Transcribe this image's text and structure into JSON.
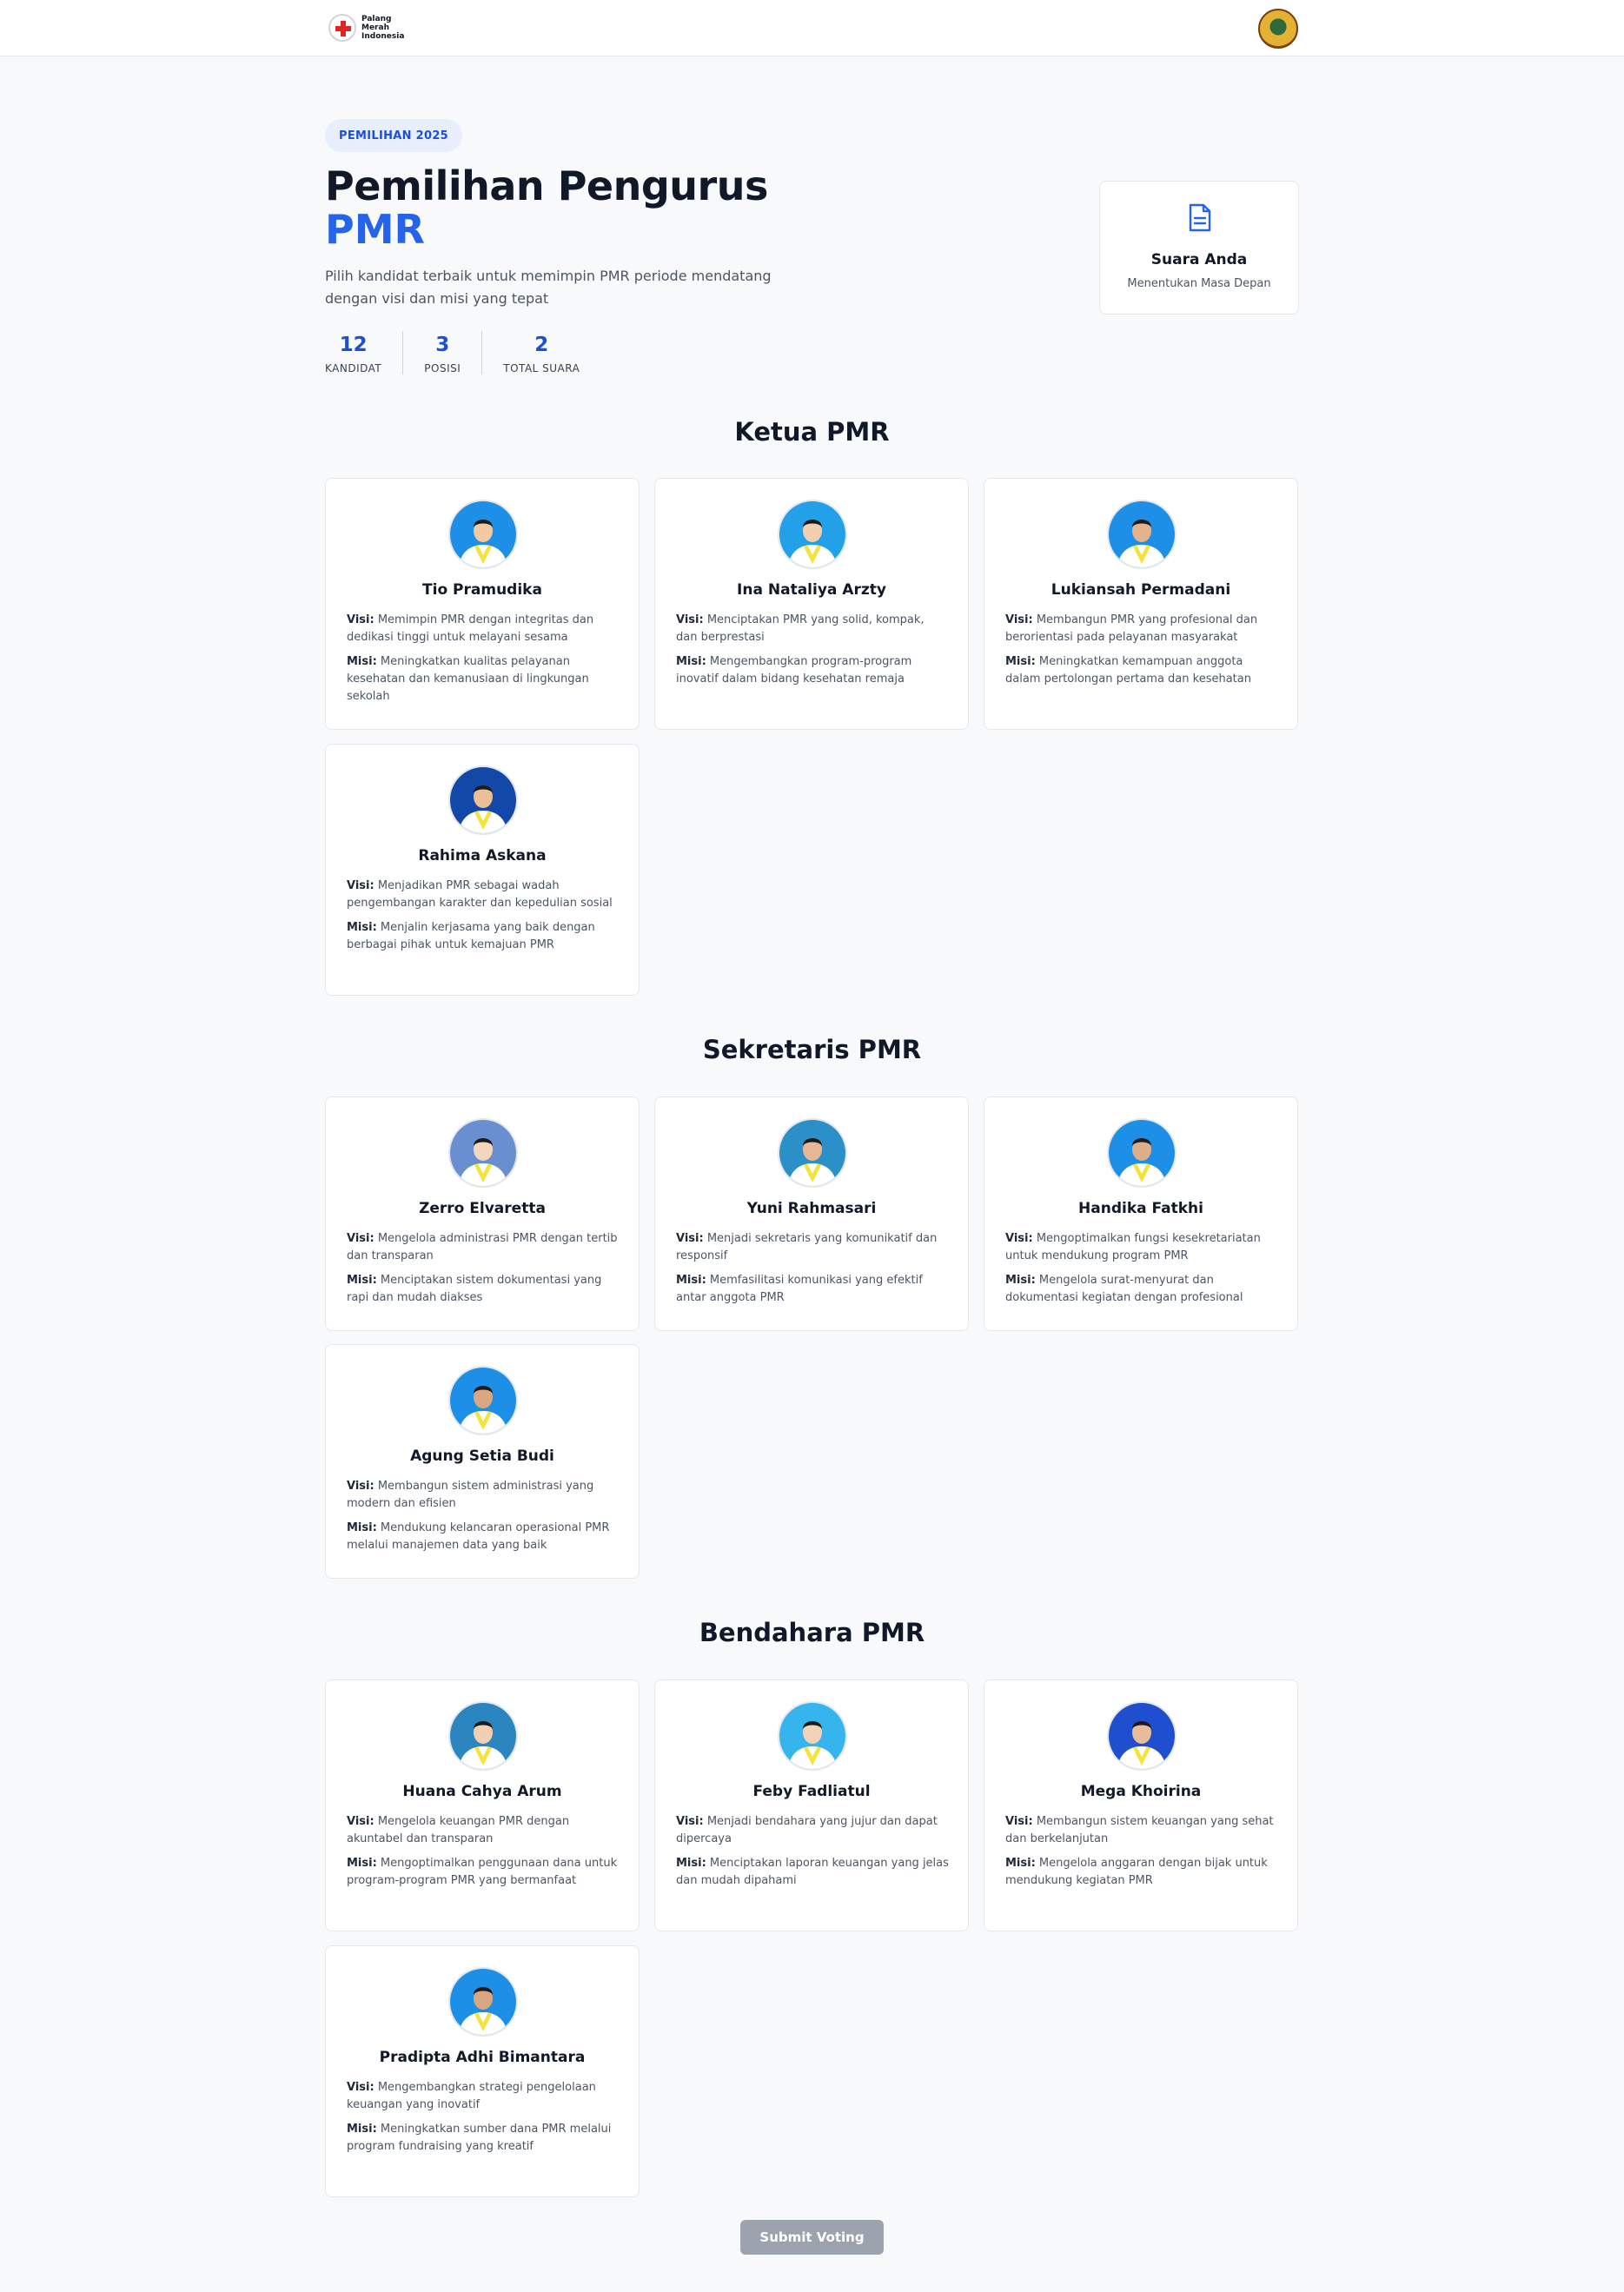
{
  "header": {
    "left_logo_text": [
      "Palang",
      "Merah",
      "Indonesia"
    ],
    "left_logo_icon": "red-cross-emblem",
    "right_logo_icon": "regional-crest"
  },
  "hero": {
    "badge": "PEMILIHAN 2025",
    "title_line1": "Pemilihan Pengurus",
    "title_line2": "PMR",
    "description": "Pilih kandidat terbaik untuk memimpin PMR periode mendatang dengan visi dan misi yang tepat",
    "stats": [
      {
        "value": "12",
        "label": "KANDIDAT"
      },
      {
        "value": "3",
        "label": "POSISI"
      },
      {
        "value": "2",
        "label": "TOTAL SUARA"
      }
    ]
  },
  "vote_card": {
    "icon": "document-icon",
    "title": "Suara Anda",
    "subtitle": "Menentukan Masa Depan"
  },
  "labels": {
    "visi": "Visi:",
    "misi": "Misi:"
  },
  "sections": [
    {
      "title": "Ketua PMR",
      "candidates": [
        {
          "name": "Tio Pramudika",
          "visi": "Memimpin PMR dengan integritas dan dedikasi tinggi untuk melayani sesama",
          "misi": "Meningkatkan kualitas pelayanan kesehatan dan kemanusiaan di lingkungan sekolah"
        },
        {
          "name": "Ina Nataliya Arzty",
          "visi": "Menciptakan PMR yang solid, kompak, dan berprestasi",
          "misi": "Mengembangkan program-program inovatif dalam bidang kesehatan remaja"
        },
        {
          "name": "Lukiansah Permadani",
          "visi": "Membangun PMR yang profesional dan berorientasi pada pelayanan masyarakat",
          "misi": "Meningkatkan kemampuan anggota dalam pertolongan pertama dan kesehatan"
        },
        {
          "name": "Rahima Askana",
          "visi": "Menjadikan PMR sebagai wadah pengembangan karakter dan kepedulian sosial",
          "misi": "Menjalin kerjasama yang baik dengan berbagai pihak untuk kemajuan PMR"
        }
      ]
    },
    {
      "title": "Sekretaris PMR",
      "candidates": [
        {
          "name": "Zerro Elvaretta",
          "visi": "Mengelola administrasi PMR dengan tertib dan transparan",
          "misi": "Menciptakan sistem dokumentasi yang rapi dan mudah diakses"
        },
        {
          "name": "Yuni Rahmasari",
          "visi": "Menjadi sekretaris yang komunikatif dan responsif",
          "misi": "Memfasilitasi komunikasi yang efektif antar anggota PMR"
        },
        {
          "name": "Handika Fatkhi",
          "visi": "Mengoptimalkan fungsi kesekretariatan untuk mendukung program PMR",
          "misi": "Mengelola surat-menyurat dan dokumentasi kegiatan dengan profesional"
        },
        {
          "name": "Agung Setia Budi",
          "visi": "Membangun sistem administrasi yang modern dan efisien",
          "misi": "Mendukung kelancaran operasional PMR melalui manajemen data yang baik"
        }
      ]
    },
    {
      "title": "Bendahara PMR",
      "candidates": [
        {
          "name": "Huana Cahya Arum",
          "visi": "Mengelola keuangan PMR dengan akuntabel dan transparan",
          "misi": "Mengoptimalkan penggunaan dana untuk program-program PMR yang bermanfaat"
        },
        {
          "name": "Feby Fadliatul",
          "visi": "Menjadi bendahara yang jujur dan dapat dipercaya",
          "misi": "Menciptakan laporan keuangan yang jelas dan mudah dipahami"
        },
        {
          "name": "Mega Khoirina",
          "visi": "Membangun sistem keuangan yang sehat dan berkelanjutan",
          "misi": "Mengelola anggaran dengan bijak untuk mendukung kegiatan PMR"
        },
        {
          "name": "Pradipta Adhi Bimantara",
          "visi": "Mengembangkan strategi pengelolaan keuangan yang inovatif",
          "misi": "Meningkatkan sumber dana PMR melalui program fundraising yang kreatif"
        }
      ]
    }
  ],
  "submit_label": "Submit Voting",
  "colors": {
    "accent": "#2563eb",
    "submit_disabled": "#9ca3af",
    "avatar_bg": "#1e90e8",
    "scarf": "#f5e23a"
  }
}
